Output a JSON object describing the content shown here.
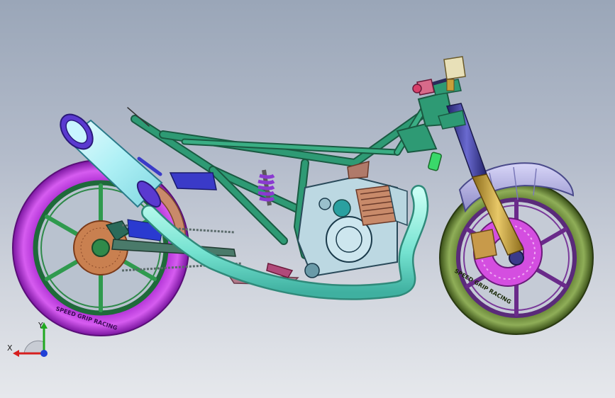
{
  "viewport": {
    "tire_sidewall_text": "SPEED GRIP RACING",
    "colors": {
      "frame": "#1f7a5c",
      "frame_light": "#2e9a74",
      "rear_tire": "#c23be0",
      "rear_tire_dark": "#8a1fb0",
      "front_tire": "#6f8a3a",
      "front_tire_dark": "#3f5a1e",
      "exhaust_pipe": "#7fe8d8",
      "muffler": "#b7f1f5",
      "muffler_cap": "#5a3ad0",
      "fork_tube": "#c9a23a",
      "fork_upper": "#3a3a9a",
      "shock_spring": "#8a3ad0",
      "engine": "#b8d6e0",
      "brake_disc_rear": "#c87a4a",
      "brake_disc_front": "#d048d8",
      "fender_front": "#b9b6e8",
      "fender_rear": "#c88a6a",
      "chain": "#6a7a7a"
    }
  },
  "triad": {
    "x_label": "X",
    "y_label": "Y",
    "x_color": "#d61f1f",
    "y_color": "#1fa81f",
    "z_color": "#1f3fd6"
  }
}
